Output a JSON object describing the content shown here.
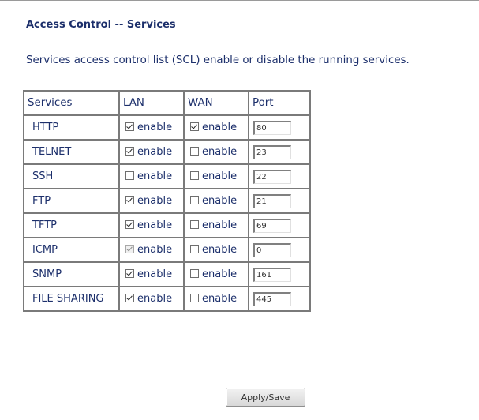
{
  "page": {
    "title": "Access Control -- Services",
    "description": "Services access control list (SCL) enable or disable the running services."
  },
  "table": {
    "headers": [
      "Services",
      "LAN",
      "WAN",
      "Port"
    ],
    "enable_label": "enable",
    "rows": [
      {
        "service": "HTTP",
        "lan_checked": true,
        "lan_disabled": false,
        "wan_checked": true,
        "port": "80"
      },
      {
        "service": "TELNET",
        "lan_checked": true,
        "lan_disabled": false,
        "wan_checked": false,
        "port": "23"
      },
      {
        "service": "SSH",
        "lan_checked": false,
        "lan_disabled": false,
        "wan_checked": false,
        "port": "22"
      },
      {
        "service": "FTP",
        "lan_checked": true,
        "lan_disabled": false,
        "wan_checked": false,
        "port": "21"
      },
      {
        "service": "TFTP",
        "lan_checked": true,
        "lan_disabled": false,
        "wan_checked": false,
        "port": "69"
      },
      {
        "service": "ICMP",
        "lan_checked": true,
        "lan_disabled": true,
        "wan_checked": false,
        "port": "0"
      },
      {
        "service": "SNMP",
        "lan_checked": true,
        "lan_disabled": false,
        "wan_checked": false,
        "port": "161"
      },
      {
        "service": "FILE SHARING",
        "lan_checked": true,
        "lan_disabled": false,
        "wan_checked": false,
        "port": "445"
      }
    ]
  },
  "apply_button_label": "Apply/Save",
  "colors": {
    "text": "#1c2f6b",
    "border": "#7a7a7a"
  }
}
